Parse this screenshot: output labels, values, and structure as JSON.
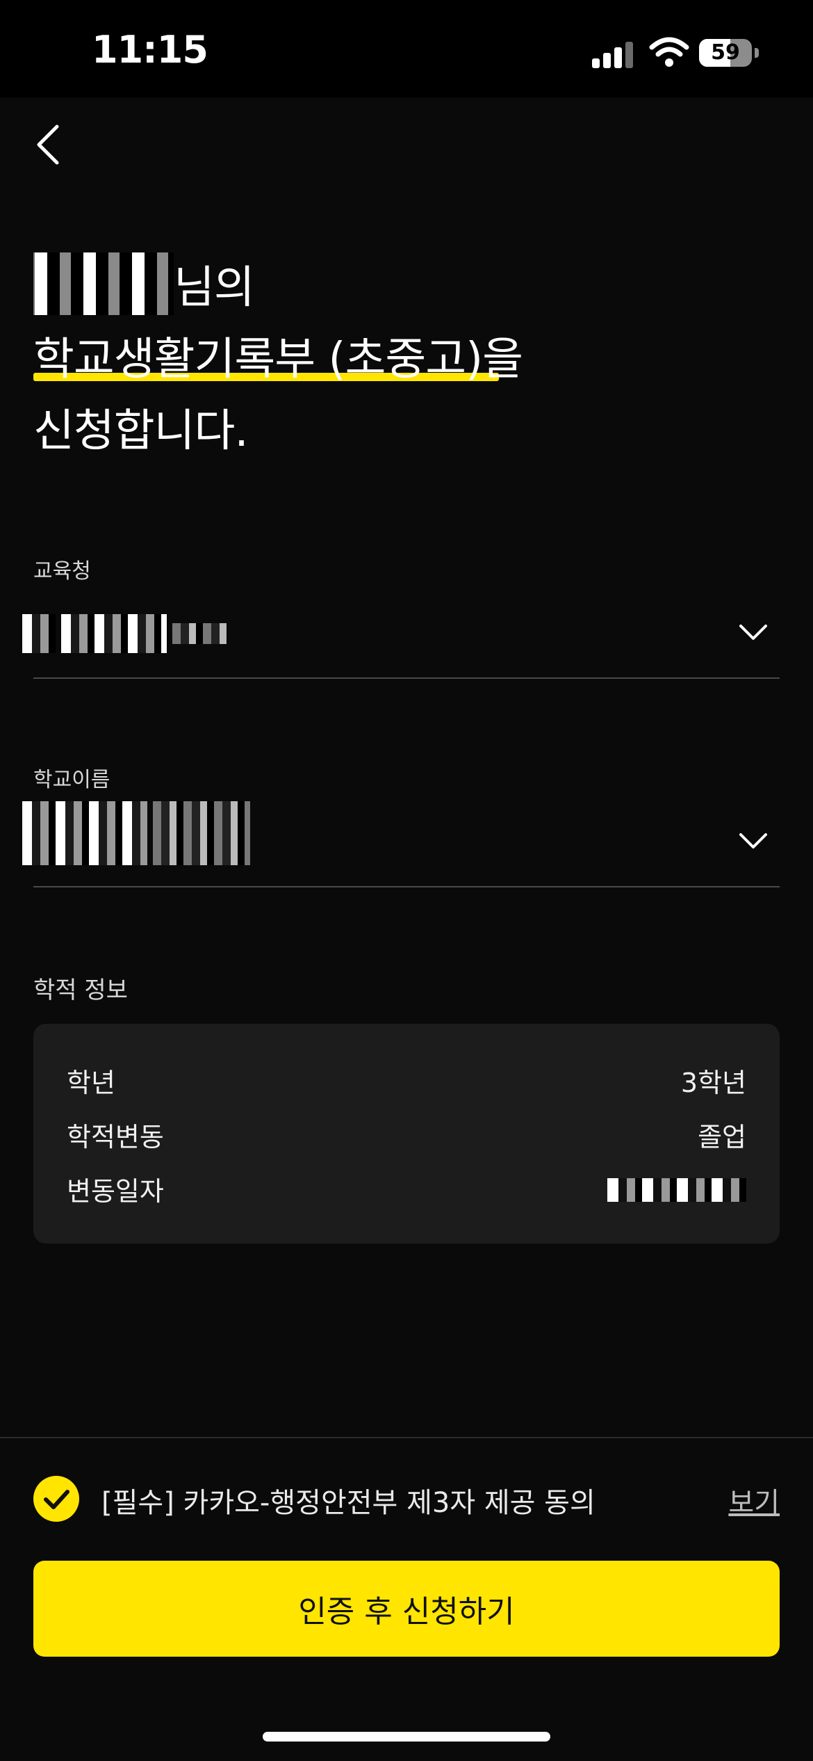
{
  "status_bar": {
    "time": "11:15",
    "battery_percent": "59",
    "battery_level": 0.59
  },
  "header": {
    "name_suffix": "님의",
    "document_name": "학교생활기록부 (초중고)",
    "particle": "을",
    "action": "신청합니다."
  },
  "form": {
    "education_office_label": "교육청",
    "school_name_label": "학교이름"
  },
  "academic_info": {
    "section_title": "학적 정보",
    "rows": [
      {
        "label": "학년",
        "value": "3학년"
      },
      {
        "label": "학적변동",
        "value": "졸업"
      },
      {
        "label": "변동일자",
        "value": ""
      }
    ]
  },
  "consent": {
    "text": "[필수] 카카오-행정안전부 제3자 제공 동의",
    "view_link": "보기"
  },
  "cta": {
    "label": "인증 후 신청하기"
  },
  "colors": {
    "accent": "#ffe500",
    "background": "#0a0a0a",
    "card": "#1c1c1c"
  }
}
